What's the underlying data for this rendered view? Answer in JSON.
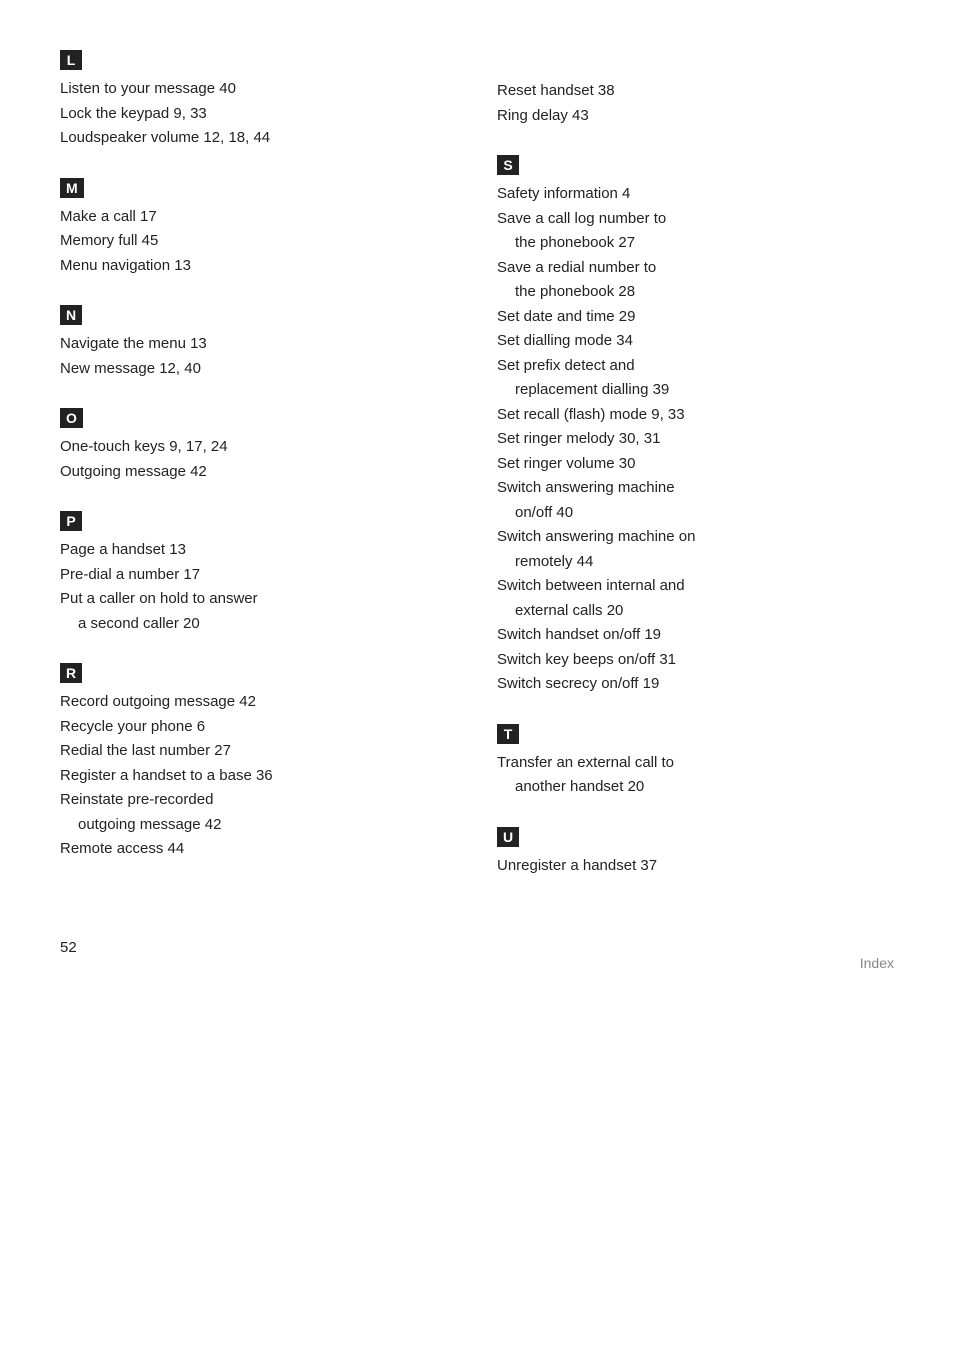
{
  "left_column": {
    "sections": [
      {
        "id": "L",
        "entries": [
          {
            "text": "Listen to your message 40"
          },
          {
            "text": "Lock the keypad 9, 33"
          },
          {
            "text": "Loudspeaker volume 12, 18, 44"
          }
        ]
      },
      {
        "id": "M",
        "entries": [
          {
            "text": "Make a call 17"
          },
          {
            "text": "Memory full 45"
          },
          {
            "text": "Menu navigation 13"
          }
        ]
      },
      {
        "id": "N",
        "entries": [
          {
            "text": "Navigate the menu 13"
          },
          {
            "text": "New message 12, 40"
          }
        ]
      },
      {
        "id": "O",
        "entries": [
          {
            "text": "One-touch keys 9, 17, 24"
          },
          {
            "text": "Outgoing message 42"
          }
        ]
      },
      {
        "id": "P",
        "entries": [
          {
            "text": "Page a handset 13"
          },
          {
            "text": "Pre-dial a number 17"
          },
          {
            "text": "Put a caller on hold to answer",
            "continuation": "a second caller 20"
          }
        ]
      },
      {
        "id": "R",
        "entries": [
          {
            "text": "Record outgoing message 42"
          },
          {
            "text": "Recycle your phone 6"
          },
          {
            "text": "Redial the last number 27"
          },
          {
            "text": "Register a handset to a base 36"
          },
          {
            "text": "Reinstate pre-recorded",
            "continuation": "outgoing message 42"
          },
          {
            "text": "Remote access 44"
          }
        ]
      }
    ]
  },
  "right_column": {
    "sections": [
      {
        "id": null,
        "entries": [
          {
            "text": "Reset handset 38"
          },
          {
            "text": "Ring delay 43"
          }
        ]
      },
      {
        "id": "S",
        "entries": [
          {
            "text": "Safety information 4"
          },
          {
            "text": "Save a call log number to",
            "continuation": "the phonebook 27"
          },
          {
            "text": "Save a redial number to",
            "continuation": "the phonebook 28"
          },
          {
            "text": "Set date and time 29"
          },
          {
            "text": "Set dialling mode 34"
          },
          {
            "text": "Set prefix detect and",
            "continuation": "replacement dialling 39"
          },
          {
            "text": "Set recall (flash) mode 9, 33"
          },
          {
            "text": "Set ringer melody 30, 31"
          },
          {
            "text": "Set ringer volume 30"
          },
          {
            "text": "Switch answering machine",
            "continuation": "on/off 40"
          },
          {
            "text": "Switch answering machine on",
            "continuation": "remotely 44"
          },
          {
            "text": "Switch between internal and",
            "continuation": "external calls 20"
          },
          {
            "text": "Switch handset on/off 19"
          },
          {
            "text": "Switch key beeps on/off 31"
          },
          {
            "text": "Switch secrecy on/off 19"
          }
        ]
      },
      {
        "id": "T",
        "entries": [
          {
            "text": "Transfer an external call to",
            "continuation": "another handset 20"
          }
        ]
      },
      {
        "id": "U",
        "entries": [
          {
            "text": "Unregister a handset 37"
          }
        ]
      }
    ]
  },
  "footer": {
    "page_number": "52",
    "page_label": "Index"
  }
}
